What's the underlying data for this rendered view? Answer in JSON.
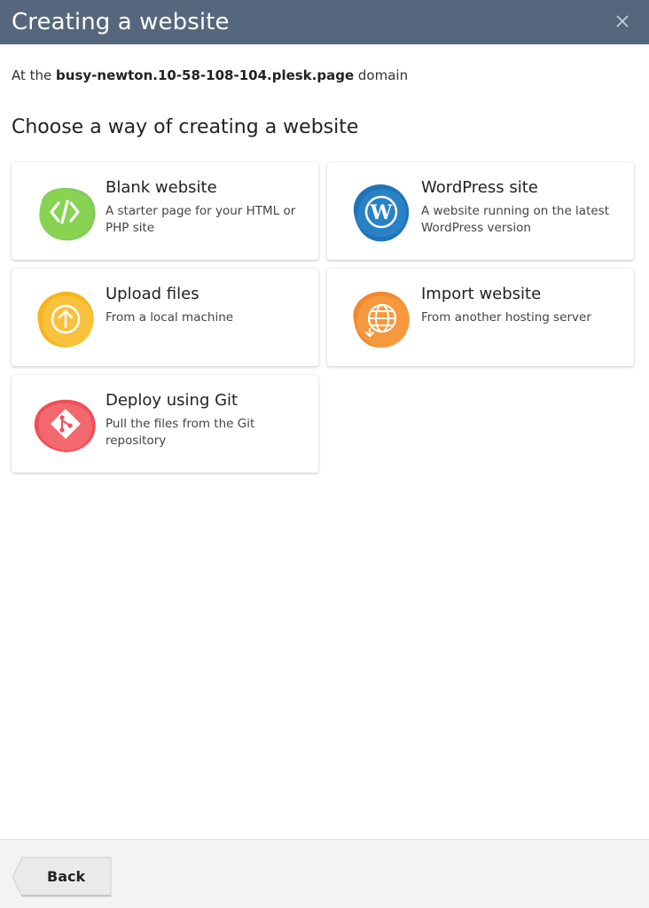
{
  "header": {
    "title": "Creating a website"
  },
  "domain_line": {
    "prefix": "At the ",
    "domain": "busy-newton.10-58-108-104.plesk.page",
    "suffix": " domain"
  },
  "section_title": "Choose a way of creating a website",
  "cards": [
    {
      "title": "Blank website",
      "description": "A starter page for your HTML or PHP site",
      "icon": "code-icon",
      "color": "#6cc43e"
    },
    {
      "title": "WordPress site",
      "description": "A website running on the latest WordPress version",
      "icon": "wordpress-icon",
      "color": "#1f74b8"
    },
    {
      "title": "Upload files",
      "description": "From a local machine",
      "icon": "upload-icon",
      "color": "#f6b51d"
    },
    {
      "title": "Import website",
      "description": "From another hosting server",
      "icon": "import-globe-icon",
      "color": "#f2892a"
    },
    {
      "title": "Deploy using Git",
      "description": "Pull the files from the Git repository",
      "icon": "git-icon",
      "color": "#ee5058"
    }
  ],
  "footer": {
    "back_label": "Back"
  }
}
